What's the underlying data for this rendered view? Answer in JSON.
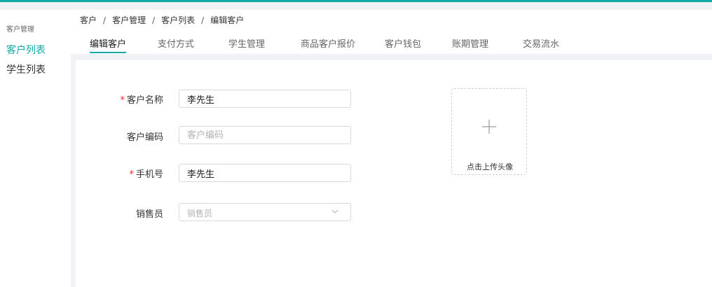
{
  "theme": {
    "accent": "#13a8a8",
    "required": "#f5222d"
  },
  "sidebar": {
    "group_title": "客户管理",
    "items": [
      {
        "label": "客户列表",
        "active": true
      },
      {
        "label": "学生列表",
        "active": false
      }
    ]
  },
  "breadcrumb": [
    "客户",
    "客户管理",
    "客户列表",
    "编辑客户"
  ],
  "breadcrumb_separator": "/",
  "tabs": [
    {
      "label": "编辑客户",
      "active": true
    },
    {
      "label": "支付方式"
    },
    {
      "label": "学生管理"
    },
    {
      "label": "商品客户报价"
    },
    {
      "label": "客户钱包"
    },
    {
      "label": "账期管理"
    },
    {
      "label": "交易流水"
    }
  ],
  "form": {
    "required_mark": "*",
    "name": {
      "label": "客户名称",
      "value": "李先生",
      "required": true
    },
    "code": {
      "label": "客户编码",
      "value": "",
      "placeholder": "客户编码"
    },
    "phone": {
      "label": "手机号",
      "value": "李先生",
      "required": true
    },
    "sales": {
      "label": "销售员",
      "placeholder": "销售员",
      "icon": "chevron-down-icon"
    }
  },
  "upload": {
    "label": "点击上传头像",
    "icon": "plus-icon"
  }
}
